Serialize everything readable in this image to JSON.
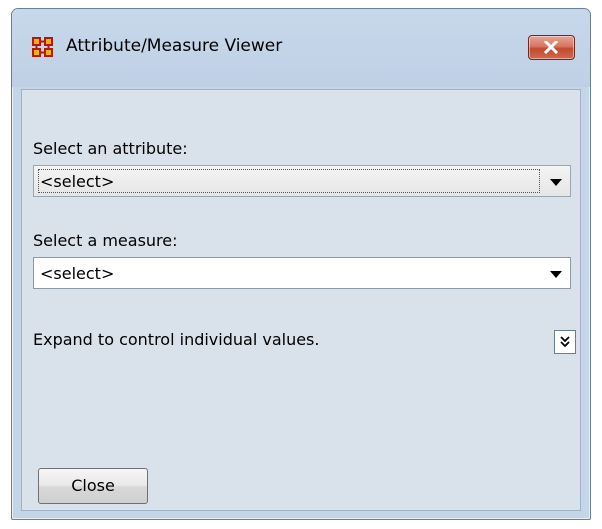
{
  "window": {
    "title": "Attribute/Measure Viewer",
    "app_icon": "network-nodes-icon",
    "close_icon": "close-icon",
    "accent_color": "#c24a30"
  },
  "attribute": {
    "label": "Select an attribute:",
    "selected": "<select>"
  },
  "measure": {
    "label": "Select a measure:",
    "selected": "<select>"
  },
  "expand": {
    "text": "Expand to control individual values.",
    "icon": "double-chevron-down-icon"
  },
  "footer": {
    "close_label": "Close"
  }
}
